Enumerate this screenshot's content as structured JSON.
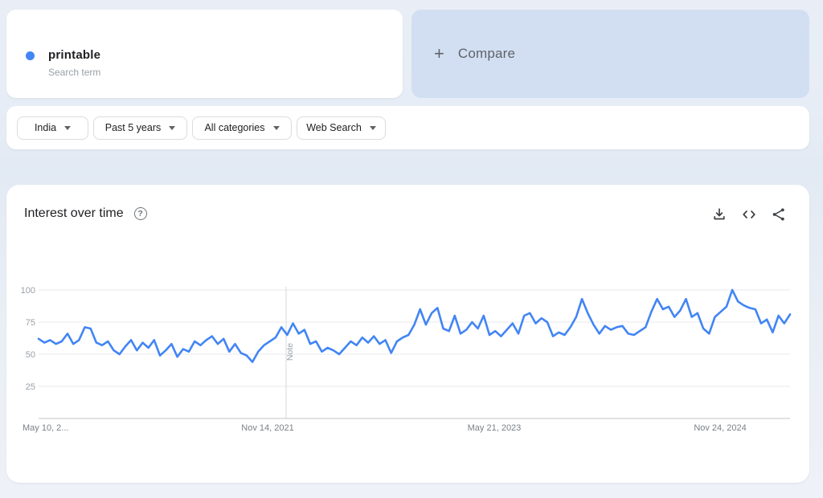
{
  "search_card": {
    "term": "printable",
    "subtitle": "Search term",
    "dot_color": "#4285f4"
  },
  "compare_card": {
    "plus_sign": "+",
    "label": "Compare"
  },
  "filter_bar": {
    "filters": [
      {
        "label": "India"
      },
      {
        "label": "Past 5 years"
      },
      {
        "label": "All categories"
      },
      {
        "label": "Web Search"
      }
    ]
  },
  "chart_section": {
    "title": "Interest over time",
    "help_symbol": "?"
  },
  "chart_data": {
    "type": "line",
    "title": "Interest over time",
    "legend_position": "none",
    "grid": true,
    "ylim": [
      0,
      100
    ],
    "y_ticks": [
      25,
      50,
      75,
      100
    ],
    "x_ticks": [
      {
        "label": "May 10, 2...",
        "frac": 0.0,
        "anchor": "start"
      },
      {
        "label": "Nov 14, 2021",
        "frac": 0.3048,
        "anchor": "middle"
      },
      {
        "label": "May 21, 2023",
        "frac": 0.6064,
        "anchor": "middle"
      },
      {
        "label": "Nov 24, 2024",
        "frac": 0.907,
        "anchor": "middle"
      }
    ],
    "note": {
      "label": "Note",
      "frac": 0.3294
    },
    "line_color": "#4285f4",
    "grid_color": "#e8eaed",
    "axis_color": "#c0c4c9",
    "y_label_color": "#9aa0a6",
    "x_label_color": "#7b8087",
    "note_color": "#9aa0a6",
    "series": [
      {
        "name": "printable",
        "color": "#4285f4",
        "values": [
          62,
          59,
          61,
          58,
          60,
          66,
          58,
          61,
          71,
          70,
          59,
          57,
          60,
          53,
          50,
          56,
          61,
          53,
          59,
          55,
          61,
          49,
          53,
          58,
          48,
          54,
          52,
          60,
          57,
          61,
          64,
          58,
          62,
          52,
          58,
          51,
          49,
          44,
          52,
          57,
          60,
          63,
          71,
          65,
          74,
          66,
          69,
          58,
          60,
          52,
          55,
          53,
          50,
          55,
          60,
          57,
          63,
          59,
          64,
          58,
          61,
          51,
          60,
          63,
          65,
          73,
          85,
          73,
          82,
          86,
          70,
          68,
          80,
          66,
          69,
          75,
          70,
          80,
          65,
          68,
          64,
          69,
          74,
          66,
          80,
          82,
          74,
          78,
          75,
          64,
          67,
          65,
          71,
          79,
          93,
          82,
          73,
          66,
          72,
          69,
          71,
          72,
          66,
          65,
          68,
          71,
          83,
          93,
          85,
          87,
          79,
          84,
          93,
          79,
          82,
          70,
          66,
          79,
          83,
          87,
          100,
          91,
          88,
          86,
          85,
          74,
          77,
          67,
          80,
          74,
          81
        ]
      }
    ]
  }
}
